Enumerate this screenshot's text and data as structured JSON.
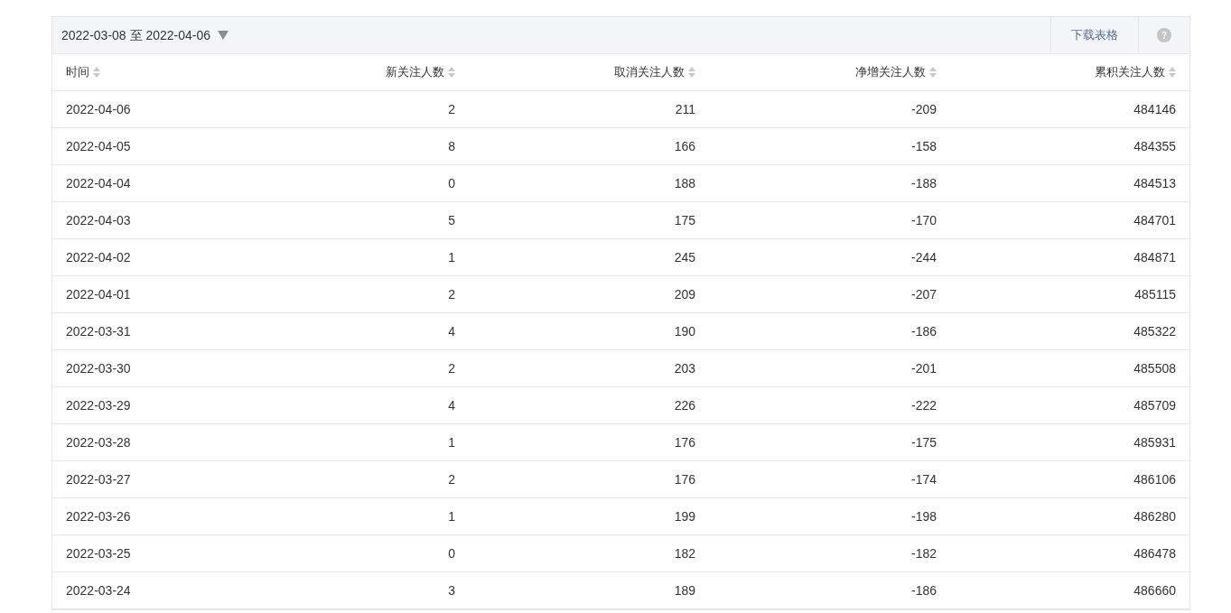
{
  "toolbar": {
    "date_range": "2022-03-08 至 2022-04-06",
    "download": "下载表格"
  },
  "table": {
    "columns": [
      "时间",
      "新关注人数",
      "取消关注人数",
      "净增关注人数",
      "累积关注人数"
    ],
    "rows": [
      [
        "2022-04-06",
        "2",
        "211",
        "-209",
        "484146"
      ],
      [
        "2022-04-05",
        "8",
        "166",
        "-158",
        "484355"
      ],
      [
        "2022-04-04",
        "0",
        "188",
        "-188",
        "484513"
      ],
      [
        "2022-04-03",
        "5",
        "175",
        "-170",
        "484701"
      ],
      [
        "2022-04-02",
        "1",
        "245",
        "-244",
        "484871"
      ],
      [
        "2022-04-01",
        "2",
        "209",
        "-207",
        "485115"
      ],
      [
        "2022-03-31",
        "4",
        "190",
        "-186",
        "485322"
      ],
      [
        "2022-03-30",
        "2",
        "203",
        "-201",
        "485508"
      ],
      [
        "2022-03-29",
        "4",
        "226",
        "-222",
        "485709"
      ],
      [
        "2022-03-28",
        "1",
        "176",
        "-175",
        "485931"
      ],
      [
        "2022-03-27",
        "2",
        "176",
        "-174",
        "486106"
      ],
      [
        "2022-03-26",
        "1",
        "199",
        "-198",
        "486280"
      ],
      [
        "2022-03-25",
        "0",
        "182",
        "-182",
        "486478"
      ],
      [
        "2022-03-24",
        "3",
        "189",
        "-186",
        "486660"
      ]
    ]
  }
}
